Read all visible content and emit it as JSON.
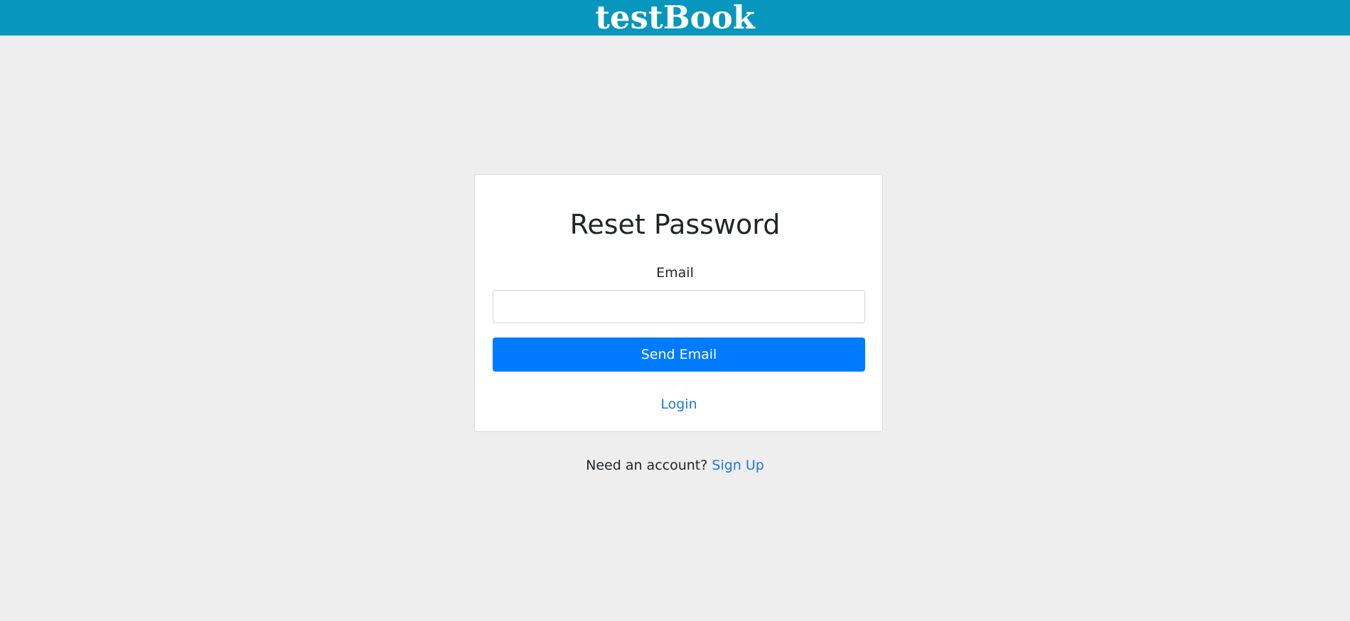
{
  "header": {
    "brand": "testBook",
    "background_color": "#0796bd"
  },
  "reset_card": {
    "title": "Reset Password",
    "email_label": "Email",
    "email_value": "",
    "send_button_label": "Send Email",
    "button_color": "#007bff",
    "login_link_label": "Login"
  },
  "signup": {
    "prompt": "Need an account?",
    "link_label": "Sign Up",
    "link_color": "#1a7ad4"
  }
}
